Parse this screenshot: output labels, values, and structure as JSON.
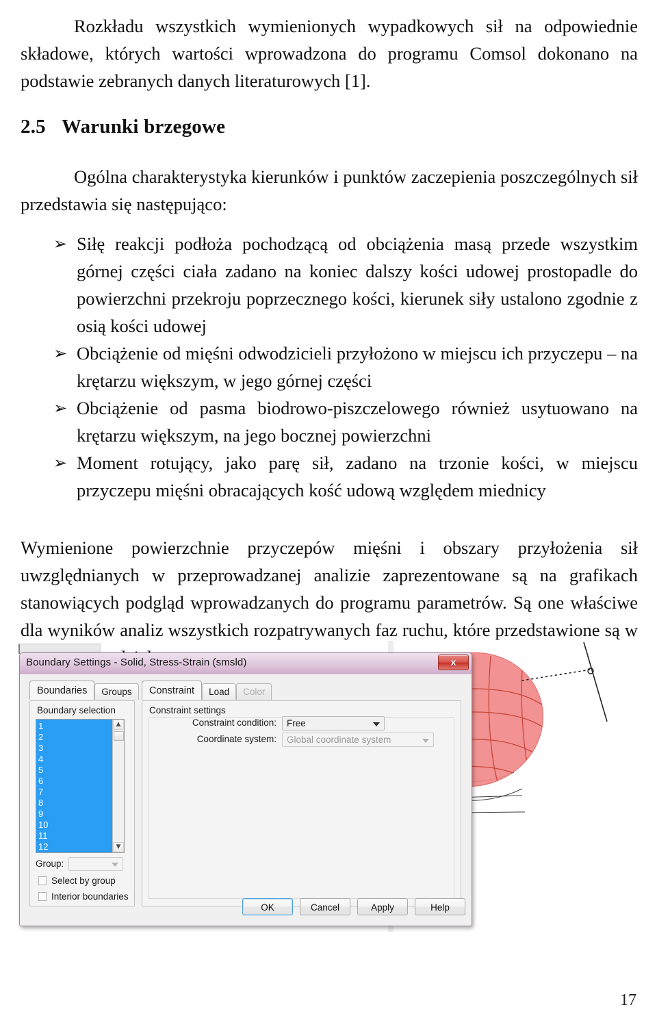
{
  "document": {
    "paragraph_1": "Rozkładu wszystkich wymienionych wypadkowych sił na odpowiednie składowe, których wartości wprowadzona do programu Comsol dokonano na podstawie zebranych danych literaturowych [1].",
    "heading": {
      "number": "2.5",
      "text": "Warunki brzegowe"
    },
    "paragraph_2": "Ogólna charakterystyka kierunków i punktów zaczepienia poszczególnych sił przedstawia się następująco:",
    "bullet_glyph": "➢",
    "bullets": [
      "Siłę reakcji podłoża pochodzącą od obciążenia masą przede wszystkim górnej części ciała zadano na koniec dalszy kości udowej prostopadle do powierzchni przekroju poprzecznego kości, kierunek siły ustalono zgodnie z osią kości udowej",
      "Obciążenie od mięśni odwodzicieli przyłożono w miejscu ich przyczepu – na krętarzu większym, w jego górnej części",
      "Obciążenie od pasma biodrowo-piszczelowego również usytuowano na krętarzu większym, na jego bocznej powierzchni",
      "Moment rotujący, jako parę sił, zadano na trzonie kości, w miejscu przyczepu mięśni obracających kość udową względem miednicy"
    ],
    "paragraph_3": "Wymienione powierzchnie przyczepów mięśni i obszary przyłożenia sił uwzględnianych w przeprowadzanej analizie zaprezentowane są na grafikach stanowiących podgląd wprowadzanych do programu parametrów. Są one właściwe dla wyników analiz wszystkich rozpatrywanych faz ruchu, które przedstawione są w kolejnym rozdziale.",
    "page_number": "17"
  },
  "figure": {
    "dialog": {
      "title": "Boundary Settings - Solid, Stress-Strain (smsld)",
      "close_label": "x",
      "left_tabs": [
        {
          "label": "Boundaries",
          "active": true
        },
        {
          "label": "Groups",
          "active": false
        }
      ],
      "right_tabs": [
        {
          "label": "Constraint",
          "active": true,
          "disabled": false
        },
        {
          "label": "Load",
          "active": false,
          "disabled": false
        },
        {
          "label": "Color",
          "active": false,
          "disabled": true
        }
      ],
      "boundary_selection": {
        "group_label": "Boundary selection",
        "items": [
          "1",
          "2",
          "3",
          "4",
          "5",
          "6",
          "7",
          "8",
          "9",
          "10",
          "11",
          "12"
        ],
        "scroll_up_glyph": "▲",
        "scroll_down_glyph": "▼",
        "group_row_label": "Group:",
        "group_value": "",
        "checkboxes": [
          {
            "label": "Select by group",
            "checked": false
          },
          {
            "label": "Interior boundaries",
            "checked": false
          }
        ]
      },
      "constraint_settings": {
        "group_label": "Constraint settings",
        "constraint_condition_label": "Constraint condition:",
        "constraint_condition_value": "Free",
        "coordinate_system_label": "Coordinate system:",
        "coordinate_system_value": "Global coordinate system",
        "coordinate_system_disabled": true
      },
      "buttons": [
        {
          "label": "OK",
          "default": true
        },
        {
          "label": "Cancel",
          "default": false
        },
        {
          "label": "Apply",
          "default": false
        },
        {
          "label": "Help",
          "default": false
        }
      ]
    },
    "viewport": {
      "description": "3D finite-element mesh of a femur with the femoral head surface highlighted",
      "highlight_color": "#f08080",
      "mesh_color": "#2b2b2b",
      "background_color": "#ffffff"
    }
  }
}
